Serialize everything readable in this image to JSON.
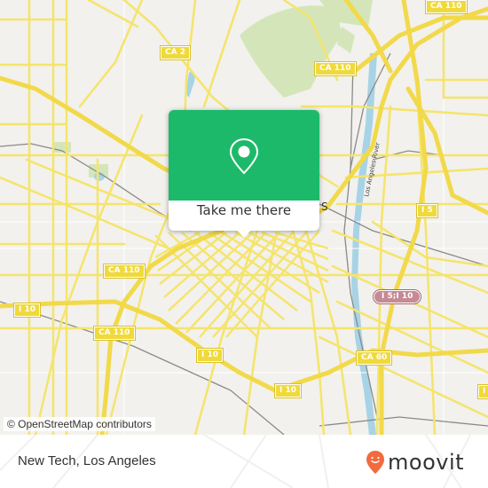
{
  "map": {
    "shields": [
      {
        "label": "CA 2",
        "type": "state"
      },
      {
        "label": "CA 110",
        "type": "state"
      },
      {
        "label": "CA 110",
        "type": "state"
      },
      {
        "label": "CA 110",
        "type": "state"
      },
      {
        "label": "CA 110",
        "type": "state"
      },
      {
        "label": "I 10",
        "type": "interstate"
      },
      {
        "label": "I 10",
        "type": "interstate"
      },
      {
        "label": "I 10",
        "type": "interstate"
      },
      {
        "label": "I 5",
        "type": "interstate"
      },
      {
        "label": "I 5;I 10",
        "type": "interstate-concurrency"
      },
      {
        "label": "CA 60",
        "type": "state"
      },
      {
        "label": "I",
        "type": "interstate"
      }
    ],
    "river_label": "Los Angeles River",
    "partial_label": "S",
    "attribution": "© OpenStreetMap contributors",
    "colors": {
      "road": "#f5e46b",
      "background": "#f2f1ed",
      "park": "#d4e6b9",
      "water": "#a8d3e6",
      "rail": "#8a8a8a"
    }
  },
  "popup": {
    "icon": "map-pin-icon",
    "button_label": "Take me there",
    "color": "#1db96a"
  },
  "footer": {
    "place_name": "New Tech, Los Angeles",
    "brand": "moovit",
    "brand_color": "#f26a3d"
  }
}
